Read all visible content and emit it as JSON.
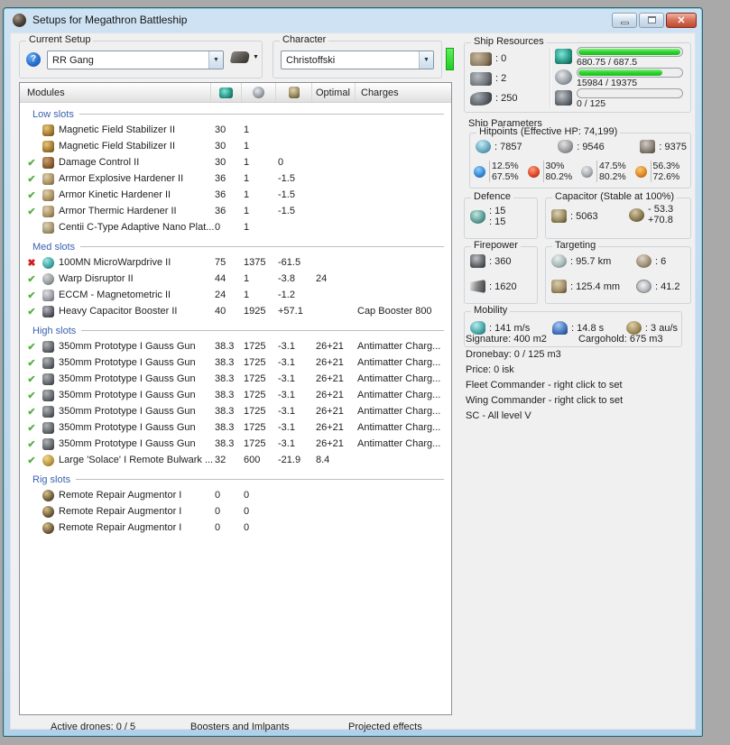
{
  "window": {
    "title": "Setups for Megathron Battleship",
    "close_glyph": "✕"
  },
  "toolbar": {
    "current_setup_label": "Current Setup",
    "current_setup_value": "RR Gang",
    "character_label": "Character",
    "character_value": "Christoffski",
    "help_glyph": "?"
  },
  "modules_table": {
    "header": {
      "modules": "Modules",
      "optimal": "Optimal",
      "charges": "Charges"
    },
    "sections": [
      {
        "label": "Low slots",
        "rows": [
          {
            "status": "",
            "icon": "magstab",
            "name": "Magnetic Field Stabilizer II",
            "cpu": "30",
            "pg": "1",
            "cap": "",
            "optimal": "",
            "charges": ""
          },
          {
            "status": "",
            "icon": "magstab",
            "name": "Magnetic Field Stabilizer II",
            "cpu": "30",
            "pg": "1",
            "cap": "",
            "optimal": "",
            "charges": ""
          },
          {
            "status": "ok",
            "icon": "damage-control",
            "name": "Damage Control II",
            "cpu": "30",
            "pg": "1",
            "cap": "0",
            "optimal": "",
            "charges": ""
          },
          {
            "status": "ok",
            "icon": "armor-hardener",
            "name": "Armor Explosive Hardener II",
            "cpu": "36",
            "pg": "1",
            "cap": "-1.5",
            "optimal": "",
            "charges": ""
          },
          {
            "status": "ok",
            "icon": "armor-hardener",
            "name": "Armor Kinetic Hardener II",
            "cpu": "36",
            "pg": "1",
            "cap": "-1.5",
            "optimal": "",
            "charges": ""
          },
          {
            "status": "ok",
            "icon": "armor-hardener",
            "name": "Armor Thermic Hardener II",
            "cpu": "36",
            "pg": "1",
            "cap": "-1.5",
            "optimal": "",
            "charges": ""
          },
          {
            "status": "",
            "icon": "armor-plate",
            "name": "Centii C-Type Adaptive Nano Plat...",
            "cpu": "0",
            "pg": "1",
            "cap": "",
            "optimal": "",
            "charges": ""
          }
        ]
      },
      {
        "label": "Med slots",
        "rows": [
          {
            "status": "err",
            "icon": "mwd",
            "name": "100MN MicroWarpdrive II",
            "cpu": "75",
            "pg": "1375",
            "cap": "-61.5",
            "optimal": "",
            "charges": ""
          },
          {
            "status": "ok",
            "icon": "disruptor",
            "name": "Warp Disruptor II",
            "cpu": "44",
            "pg": "1",
            "cap": "-3.8",
            "optimal": "24",
            "charges": ""
          },
          {
            "status": "ok",
            "icon": "eccm",
            "name": "ECCM - Magnetometric II",
            "cpu": "24",
            "pg": "1",
            "cap": "-1.2",
            "optimal": "",
            "charges": ""
          },
          {
            "status": "ok",
            "icon": "capbooster",
            "name": "Heavy Capacitor Booster II",
            "cpu": "40",
            "pg": "1925",
            "cap": "+57.1",
            "optimal": "",
            "charges": "Cap Booster 800"
          }
        ]
      },
      {
        "label": "High slots",
        "rows": [
          {
            "status": "ok",
            "icon": "gun",
            "name": "350mm Prototype I Gauss Gun",
            "cpu": "38.3",
            "pg": "1725",
            "cap": "-3.1",
            "optimal": "26+21",
            "charges": "Antimatter Charg..."
          },
          {
            "status": "ok",
            "icon": "gun",
            "name": "350mm Prototype I Gauss Gun",
            "cpu": "38.3",
            "pg": "1725",
            "cap": "-3.1",
            "optimal": "26+21",
            "charges": "Antimatter Charg..."
          },
          {
            "status": "ok",
            "icon": "gun",
            "name": "350mm Prototype I Gauss Gun",
            "cpu": "38.3",
            "pg": "1725",
            "cap": "-3.1",
            "optimal": "26+21",
            "charges": "Antimatter Charg..."
          },
          {
            "status": "ok",
            "icon": "gun",
            "name": "350mm Prototype I Gauss Gun",
            "cpu": "38.3",
            "pg": "1725",
            "cap": "-3.1",
            "optimal": "26+21",
            "charges": "Antimatter Charg..."
          },
          {
            "status": "ok",
            "icon": "gun",
            "name": "350mm Prototype I Gauss Gun",
            "cpu": "38.3",
            "pg": "1725",
            "cap": "-3.1",
            "optimal": "26+21",
            "charges": "Antimatter Charg..."
          },
          {
            "status": "ok",
            "icon": "gun",
            "name": "350mm Prototype I Gauss Gun",
            "cpu": "38.3",
            "pg": "1725",
            "cap": "-3.1",
            "optimal": "26+21",
            "charges": "Antimatter Charg..."
          },
          {
            "status": "ok",
            "icon": "gun",
            "name": "350mm Prototype I Gauss Gun",
            "cpu": "38.3",
            "pg": "1725",
            "cap": "-3.1",
            "optimal": "26+21",
            "charges": "Antimatter Charg..."
          },
          {
            "status": "ok",
            "icon": "remote-armor",
            "name": "Large 'Solace' I Remote Bulwark ...",
            "cpu": "32",
            "pg": "600",
            "cap": "-21.9",
            "optimal": "8.4",
            "charges": ""
          }
        ]
      },
      {
        "label": "Rig slots",
        "rows": [
          {
            "status": "",
            "icon": "rig",
            "name": "Remote Repair Augmentor I",
            "cpu": "0",
            "pg": "0",
            "cap": "",
            "optimal": "",
            "charges": ""
          },
          {
            "status": "",
            "icon": "rig",
            "name": "Remote Repair Augmentor I",
            "cpu": "0",
            "pg": "0",
            "cap": "",
            "optimal": "",
            "charges": ""
          },
          {
            "status": "",
            "icon": "rig",
            "name": "Remote Repair Augmentor I",
            "cpu": "0",
            "pg": "0",
            "cap": "",
            "optimal": "",
            "charges": ""
          }
        ]
      }
    ]
  },
  "ship_resources": {
    "label": "Ship Resources",
    "turrets": ": 0",
    "launchers": ": 2",
    "calibration": ": 250",
    "bars": [
      {
        "icon": "cpu",
        "text": "680.75 / 687.5",
        "pct": 99
      },
      {
        "icon": "powergrid",
        "text": "15984 / 19375",
        "pct": 82
      },
      {
        "icon": "drone",
        "text": "0 / 125",
        "pct": 0
      }
    ]
  },
  "ship_parameters": {
    "label": "Ship Parameters",
    "hitpoints": {
      "label": "Hitpoints (Effective HP: 74,199)",
      "shield": ": 7857",
      "armor": ": 9546",
      "structure": ": 9375",
      "resists": [
        {
          "type": "em",
          "shield": "12.5%",
          "armor": "67.5%"
        },
        {
          "type": "thermal",
          "shield": "30%",
          "armor": "80.2%"
        },
        {
          "type": "kinetic",
          "shield": "47.5%",
          "armor": "80.2%"
        },
        {
          "type": "explosive",
          "shield": "56.3%",
          "armor": "72.6%"
        }
      ]
    },
    "defence": {
      "label": "Defence",
      "value1": ": 15",
      "value2": ": 15"
    },
    "capacitor": {
      "label": "Capacitor (Stable at 100%)",
      "amount": ": 5063",
      "delta_out": "- 53.3",
      "delta_in": "+70.8"
    },
    "firepower": {
      "label": "Firepower",
      "dps": ": 360",
      "volley": ": 1620"
    },
    "targeting": {
      "label": "Targeting",
      "range": ": 95.7 km",
      "max_targets": ": 6",
      "scan_res": ": 125.4 mm",
      "sensor_strength": ": 41.2"
    },
    "mobility": {
      "label": "Mobility",
      "speed": ": 141 m/s",
      "align_time": ": 14.8 s",
      "warp_speed": ": 3 au/s"
    }
  },
  "summary": {
    "signature": "Signature: 400 m2",
    "cargohold": "Cargohold: 675 m3",
    "dronebay": "Dronebay: 0 / 125 m3",
    "price": "Price: 0 isk",
    "fleet_commander": "Fleet Commander - right click to set",
    "wing_commander": "Wing Commander - right click to set",
    "sc": "SC - All level V"
  },
  "footer": {
    "active_drones": "Active drones: 0 / 5",
    "boosters": "Boosters and Imlpants",
    "projected": "Projected effects"
  },
  "colors": {
    "accent_green": "#30d830",
    "ok_check": "#55b344",
    "error_x": "#cc1f1f",
    "section_blue": "#3a62b0"
  }
}
